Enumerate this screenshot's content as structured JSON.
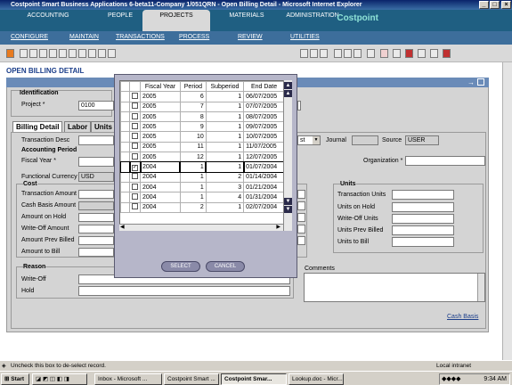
{
  "window": {
    "title": "Costpoint Smart Business Applications 6-beta11-Company 1/051QRN - Open Billing Detail - Microsoft Internet Explorer"
  },
  "modules": [
    {
      "label": "ACCOUNTING"
    },
    {
      "label": "PEOPLE"
    },
    {
      "label": "PROJECTS",
      "selected": true
    },
    {
      "label": "MATERIALS"
    },
    {
      "label": "ADMINISTRATION"
    }
  ],
  "brand": "Costpoint",
  "submenu": [
    "CONFIGURE",
    "MAINTAIN",
    "TRANSACTIONS",
    "PROCESS",
    "REVIEW",
    "UTILITIES"
  ],
  "page_title": "OPEN BILLING DETAIL",
  "identification": {
    "heading": "Identification",
    "project_label": "Project",
    "project_value": "0100"
  },
  "tabs": [
    "Billing Detail",
    "Labor",
    "Units"
  ],
  "header_fields": {
    "transaction_desc": "Transaction Desc",
    "journal": "Journal",
    "source": "Source",
    "source_value": "USER",
    "source_combo_value": "st",
    "organization": "Organization",
    "required_mark": "*"
  },
  "accounting_period": {
    "heading": "Accounting Period",
    "fiscal_year": "Fiscal Year"
  },
  "functional_currency": {
    "label": "Functional Currency",
    "value": "USD"
  },
  "cost": {
    "heading": "Cost",
    "fields": [
      "Transaction Amount",
      "Cash Basis Amount",
      "Amount on Hold",
      "Write-Off Amount",
      "Amount Prev Billed",
      "Amount to Bill"
    ]
  },
  "units": {
    "heading": "Units",
    "fields": [
      "Transaction Units",
      "Units on Hold",
      "Write-Off Units",
      "Units Prev Billed",
      "Units to Bill"
    ]
  },
  "reason": {
    "heading": "Reason",
    "fields": [
      "Write-Off",
      "Hold"
    ]
  },
  "comments": {
    "label": "Comments"
  },
  "cash_basis_link": "Cash Basis",
  "lookup": {
    "columns": [
      "Fiscal Year",
      "Period",
      "Subperiod",
      "End Date"
    ],
    "rows": [
      {
        "checked": false,
        "year": "2005",
        "period": "6",
        "sub": "1",
        "end": "06/07/2005"
      },
      {
        "checked": false,
        "year": "2005",
        "period": "7",
        "sub": "1",
        "end": "07/07/2005"
      },
      {
        "checked": false,
        "year": "2005",
        "period": "8",
        "sub": "1",
        "end": "08/07/2005"
      },
      {
        "checked": false,
        "year": "2005",
        "period": "9",
        "sub": "1",
        "end": "09/07/2005"
      },
      {
        "checked": false,
        "year": "2005",
        "period": "10",
        "sub": "1",
        "end": "10/07/2005"
      },
      {
        "checked": false,
        "year": "2005",
        "period": "11",
        "sub": "1",
        "end": "11/07/2005"
      },
      {
        "checked": false,
        "year": "2005",
        "period": "12",
        "sub": "1",
        "end": "12/07/2005"
      },
      {
        "checked": true,
        "year": "2004",
        "period": "1",
        "sub": "1",
        "end": "01/07/2004"
      },
      {
        "checked": false,
        "year": "2004",
        "period": "1",
        "sub": "2",
        "end": "01/14/2004"
      },
      {
        "checked": false,
        "year": "2004",
        "period": "1",
        "sub": "3",
        "end": "01/21/2004"
      },
      {
        "checked": false,
        "year": "2004",
        "period": "1",
        "sub": "4",
        "end": "01/31/2004"
      },
      {
        "checked": false,
        "year": "2004",
        "period": "2",
        "sub": "1",
        "end": "02/07/2004"
      }
    ],
    "select_label": "SELECT",
    "cancel_label": "CANCEL"
  },
  "status_text": "Uncheck this box to de-select record.",
  "zone_text": "Local intranet",
  "taskbar": {
    "start": "Start",
    "tasks": [
      "Inbox - Microsoft ...",
      "Costpoint Smart ...",
      "Costpoint Smar...",
      "Lookup.doc - Micr..."
    ],
    "clock": "9:34 AM"
  }
}
